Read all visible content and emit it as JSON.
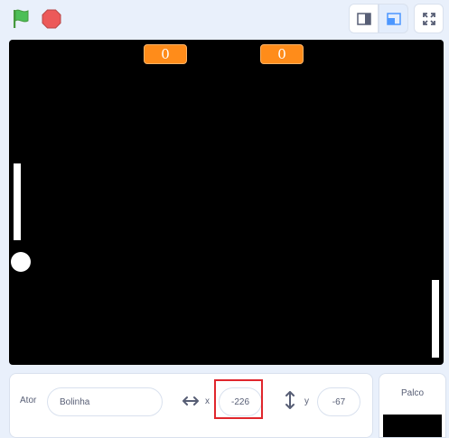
{
  "toolbar": {
    "green_flag_icon": "green-flag-icon",
    "stop_icon": "stop-sign-icon",
    "small_stage_icon": "small-stage-icon",
    "normal_stage_icon": "normal-stage-icon",
    "fullscreen_icon": "fullscreen-icon"
  },
  "stage": {
    "score_left": "0",
    "score_right": "0"
  },
  "sprite_info": {
    "sprite_label": "Ator",
    "sprite_name": "Bolinha",
    "x_label": "x",
    "x_value": "-226",
    "y_label": "y",
    "y_value": "-67"
  },
  "stage_panel": {
    "title": "Palco"
  },
  "colors": {
    "score_bg": "#ff8c1a",
    "highlight": "#e0262c",
    "flag_green": "#4cbf56",
    "stop_red": "#ec5959"
  }
}
